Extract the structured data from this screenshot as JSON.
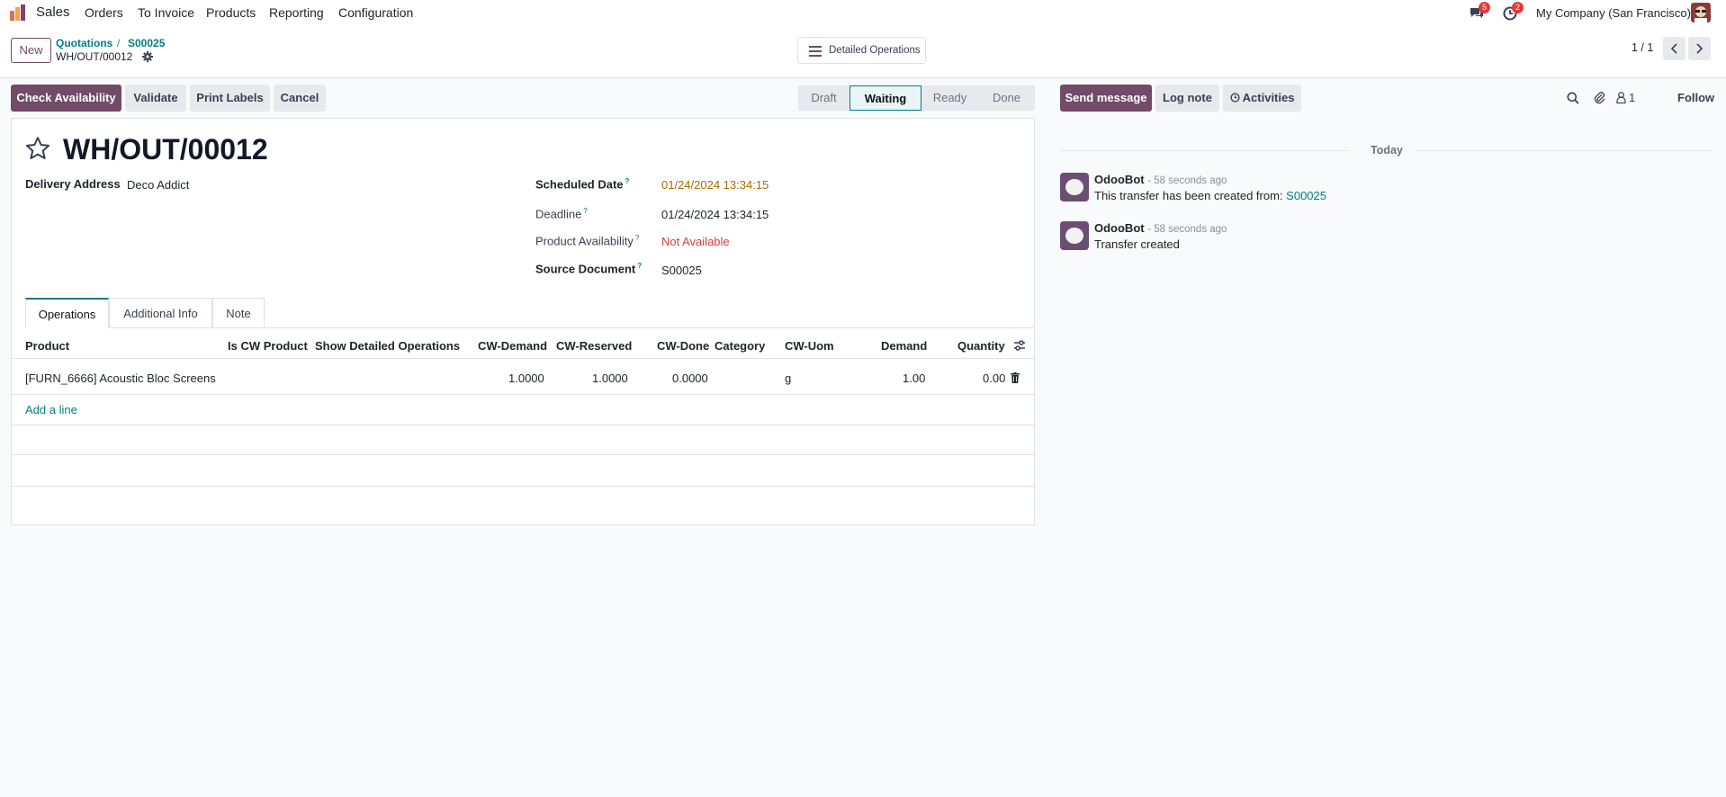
{
  "nav": {
    "app_name": "Sales",
    "menu": [
      "Orders",
      "To Invoice",
      "Products",
      "Reporting",
      "Configuration"
    ],
    "messages_badge": "5",
    "activities_badge": "2",
    "company": "My Company (San Francisco)"
  },
  "control": {
    "new_label": "New",
    "breadcrumb_parent": "Quotations",
    "breadcrumb_sep": "/",
    "breadcrumb_order": "S00025",
    "record_name": "WH/OUT/00012",
    "detailed_ops_label": "Detailed Operations",
    "pager": "1 / 1"
  },
  "actions": {
    "check_availability": "Check Availability",
    "validate": "Validate",
    "print_labels": "Print Labels",
    "cancel": "Cancel"
  },
  "statusbar": [
    "Draft",
    "Waiting",
    "Ready",
    "Done"
  ],
  "statusbar_active": "Waiting",
  "form": {
    "title": "WH/OUT/00012",
    "delivery_address_label": "Delivery Address",
    "delivery_address": "Deco Addict",
    "scheduled_date_label": "Scheduled Date",
    "scheduled_date": "01/24/2024 13:34:15",
    "deadline_label": "Deadline",
    "deadline": "01/24/2024 13:34:15",
    "availability_label": "Product Availability",
    "availability": "Not Available",
    "source_label": "Source Document",
    "source": "S00025",
    "help_mark": "?"
  },
  "tabs": [
    "Operations",
    "Additional Info",
    "Note"
  ],
  "table": {
    "headers": [
      "Product",
      "Is CW Product",
      "Show Detailed Operations",
      "CW-Demand",
      "CW-Reserved",
      "CW-Done",
      "Category",
      "CW-Uom",
      "Demand",
      "Quantity"
    ],
    "rows": [
      [
        "[FURN_6666] Acoustic Bloc Screens",
        "",
        "",
        "1.0000",
        "1.0000",
        "0.0000",
        "",
        "g",
        "1.00",
        "0.00"
      ]
    ],
    "add_line": "Add a line"
  },
  "chatter": {
    "send_message": "Send message",
    "log_note": "Log note",
    "activities": "Activities",
    "followers_count": "1",
    "follow": "Follow",
    "date_separator": "Today",
    "messages": [
      {
        "author": "OdooBot",
        "time": "- 58 seconds ago",
        "text": "This transfer has been created from:",
        "link": "S00025"
      },
      {
        "author": "OdooBot",
        "time": "- 58 seconds ago",
        "text": "Transfer created",
        "link": ""
      }
    ]
  },
  "colors": {
    "brand": "#714b67",
    "link": "#017e84",
    "warning": "#a86b00",
    "danger": "#d23f3a"
  }
}
